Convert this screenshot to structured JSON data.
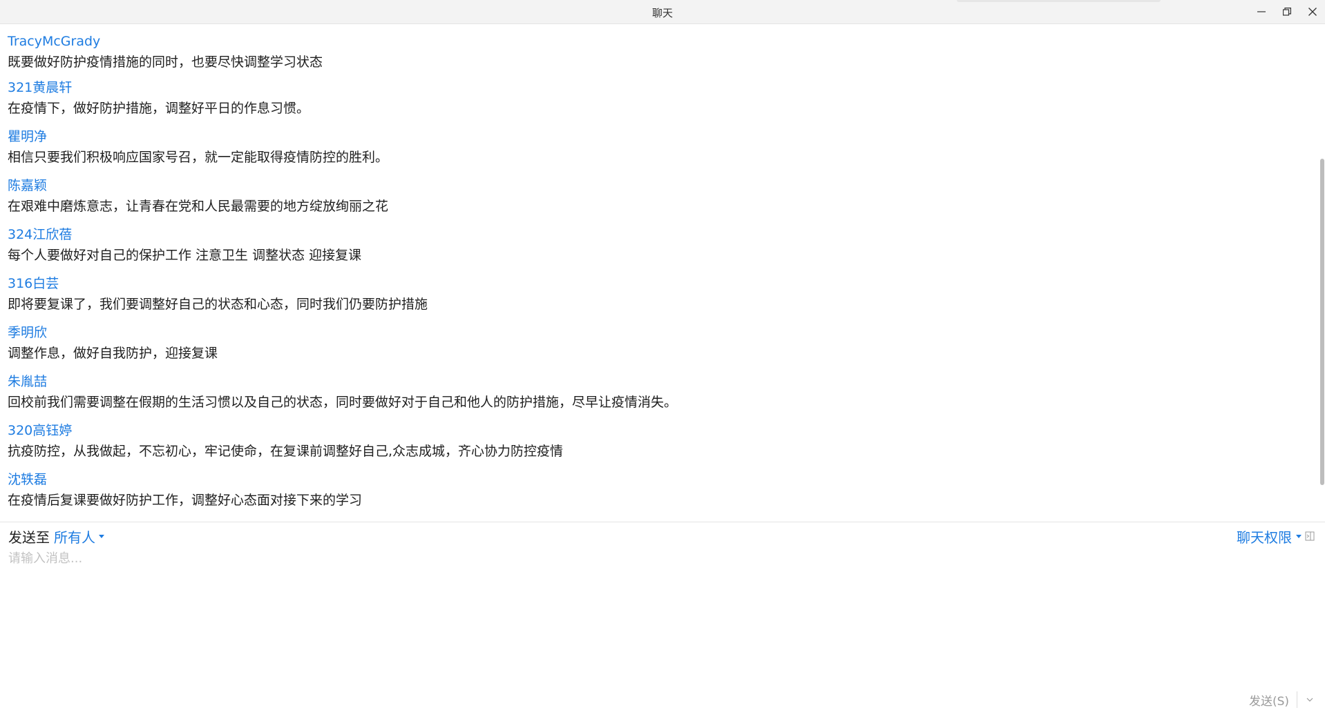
{
  "window": {
    "title": "聊天",
    "minimize_icon": "minimize-icon",
    "maximize_icon": "restore-icon",
    "close_icon": "close-icon"
  },
  "messages": [
    {
      "sender": "TracyMcGrady",
      "text": "既要做好防护疫情措施的同时，也要尽快调整学习状态"
    },
    {
      "sender": "321黄晨轩",
      "text": "在疫情下，做好防护措施，调整好平日的作息习惯。"
    },
    {
      "sender": " 瞿明净",
      "text": "相信只要我们积极响应国家号召，就一定能取得疫情防控的胜利。"
    },
    {
      "sender": "陈嘉颖",
      "text": "在艰难中磨炼意志，让青春在党和人民最需要的地方绽放绚丽之花"
    },
    {
      "sender": "324江欣蓓",
      "text": "每个人要做好对自己的保护工作 注意卫生 调整状态 迎接复课"
    },
    {
      "sender": "316白芸",
      "text": "即将要复课了，我们要调整好自己的状态和心态，同时我们仍要防护措施"
    },
    {
      "sender": "季明欣",
      "text": "调整作息，做好自我防护，迎接复课"
    },
    {
      "sender": "朱胤喆",
      "text": "回校前我们需要调整在假期的生活习惯以及自己的状态，同时要做好对于自己和他人的防护措施，尽早让疫情消失。"
    },
    {
      "sender": "320高钰婷",
      "text": "抗疫防控，从我做起，不忘初心，牢记使命，在复课前调整好自己,众志成城，齐心协力防控疫情"
    },
    {
      "sender": "沈轶磊",
      "text": "在疫情后复课要做好防护工作，调整好心态面对接下来的学习"
    }
  ],
  "composer": {
    "send_to_label": "发送至",
    "recipient": "所有人",
    "permissions_label": "聊天权限",
    "input_placeholder": "请输入消息...",
    "send_button": "发送(S)"
  },
  "colors": {
    "accent": "#1e7ce1",
    "text": "#1f1f1f",
    "titlebar": "#f3f3f3",
    "placeholder": "#c2c2c2"
  }
}
